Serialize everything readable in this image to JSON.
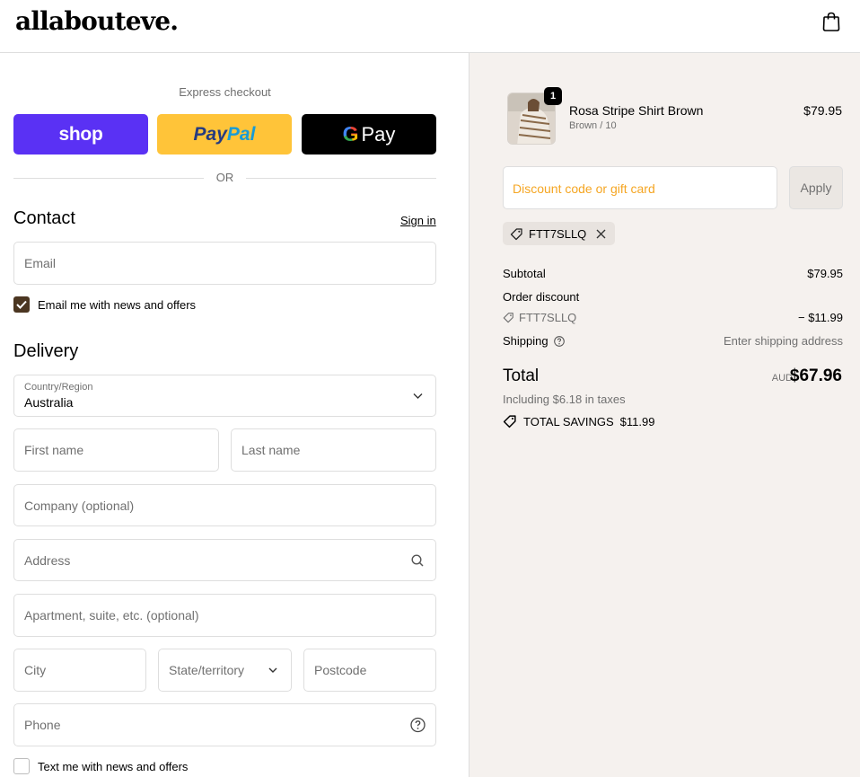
{
  "header": {
    "logo": "allabouteve."
  },
  "express": {
    "label": "Express checkout",
    "shop_label": "shop",
    "paypal_part1": "Pay",
    "paypal_part2": "Pal",
    "gpay_g": "G",
    "gpay_label": "Pay",
    "or_label": "OR"
  },
  "contact": {
    "title": "Contact",
    "signin_label": "Sign in",
    "email_placeholder": "Email",
    "newsletter_label": "Email me with news and offers",
    "newsletter_checked": true
  },
  "delivery": {
    "title": "Delivery",
    "country_label": "Country/Region",
    "country_value": "Australia",
    "first_name_placeholder": "First name",
    "last_name_placeholder": "Last name",
    "company_placeholder": "Company (optional)",
    "address_placeholder": "Address",
    "apartment_placeholder": "Apartment, suite, etc. (optional)",
    "city_placeholder": "City",
    "state_placeholder": "State/territory",
    "postcode_placeholder": "Postcode",
    "phone_placeholder": "Phone",
    "sms_label": "Text me with news and offers",
    "sms_checked": false
  },
  "order": {
    "product": {
      "name": "Rosa Stripe Shirt Brown",
      "variant": "Brown / 10",
      "price": "$79.95",
      "quantity": "1"
    },
    "discount_placeholder": "Discount code or gift card",
    "apply_label": "Apply",
    "applied_code": "FTT7SLLQ",
    "subtotal_label": "Subtotal",
    "subtotal_value": "$79.95",
    "order_discount_label": "Order discount",
    "order_discount_code": "FTT7SLLQ",
    "order_discount_value": "− $11.99",
    "shipping_label": "Shipping",
    "shipping_value": "Enter shipping address",
    "total_label": "Total",
    "total_currency": "AUD",
    "total_value": "$67.96",
    "taxes_note": "Including $6.18 in taxes",
    "savings_label": "TOTAL SAVINGS",
    "savings_value": "$11.99"
  },
  "colors": {
    "shop_purple": "#5a31f4",
    "paypal_yellow": "#ffc439",
    "checkbox_brown": "#4b3621",
    "summary_bg": "#f5f1ee",
    "discount_placeholder_color": "#f5a623"
  },
  "icons": [
    "shopping-bag-icon",
    "chevron-down-icon",
    "search-icon",
    "help-circle-icon",
    "check-icon",
    "tag-icon",
    "close-icon"
  ]
}
